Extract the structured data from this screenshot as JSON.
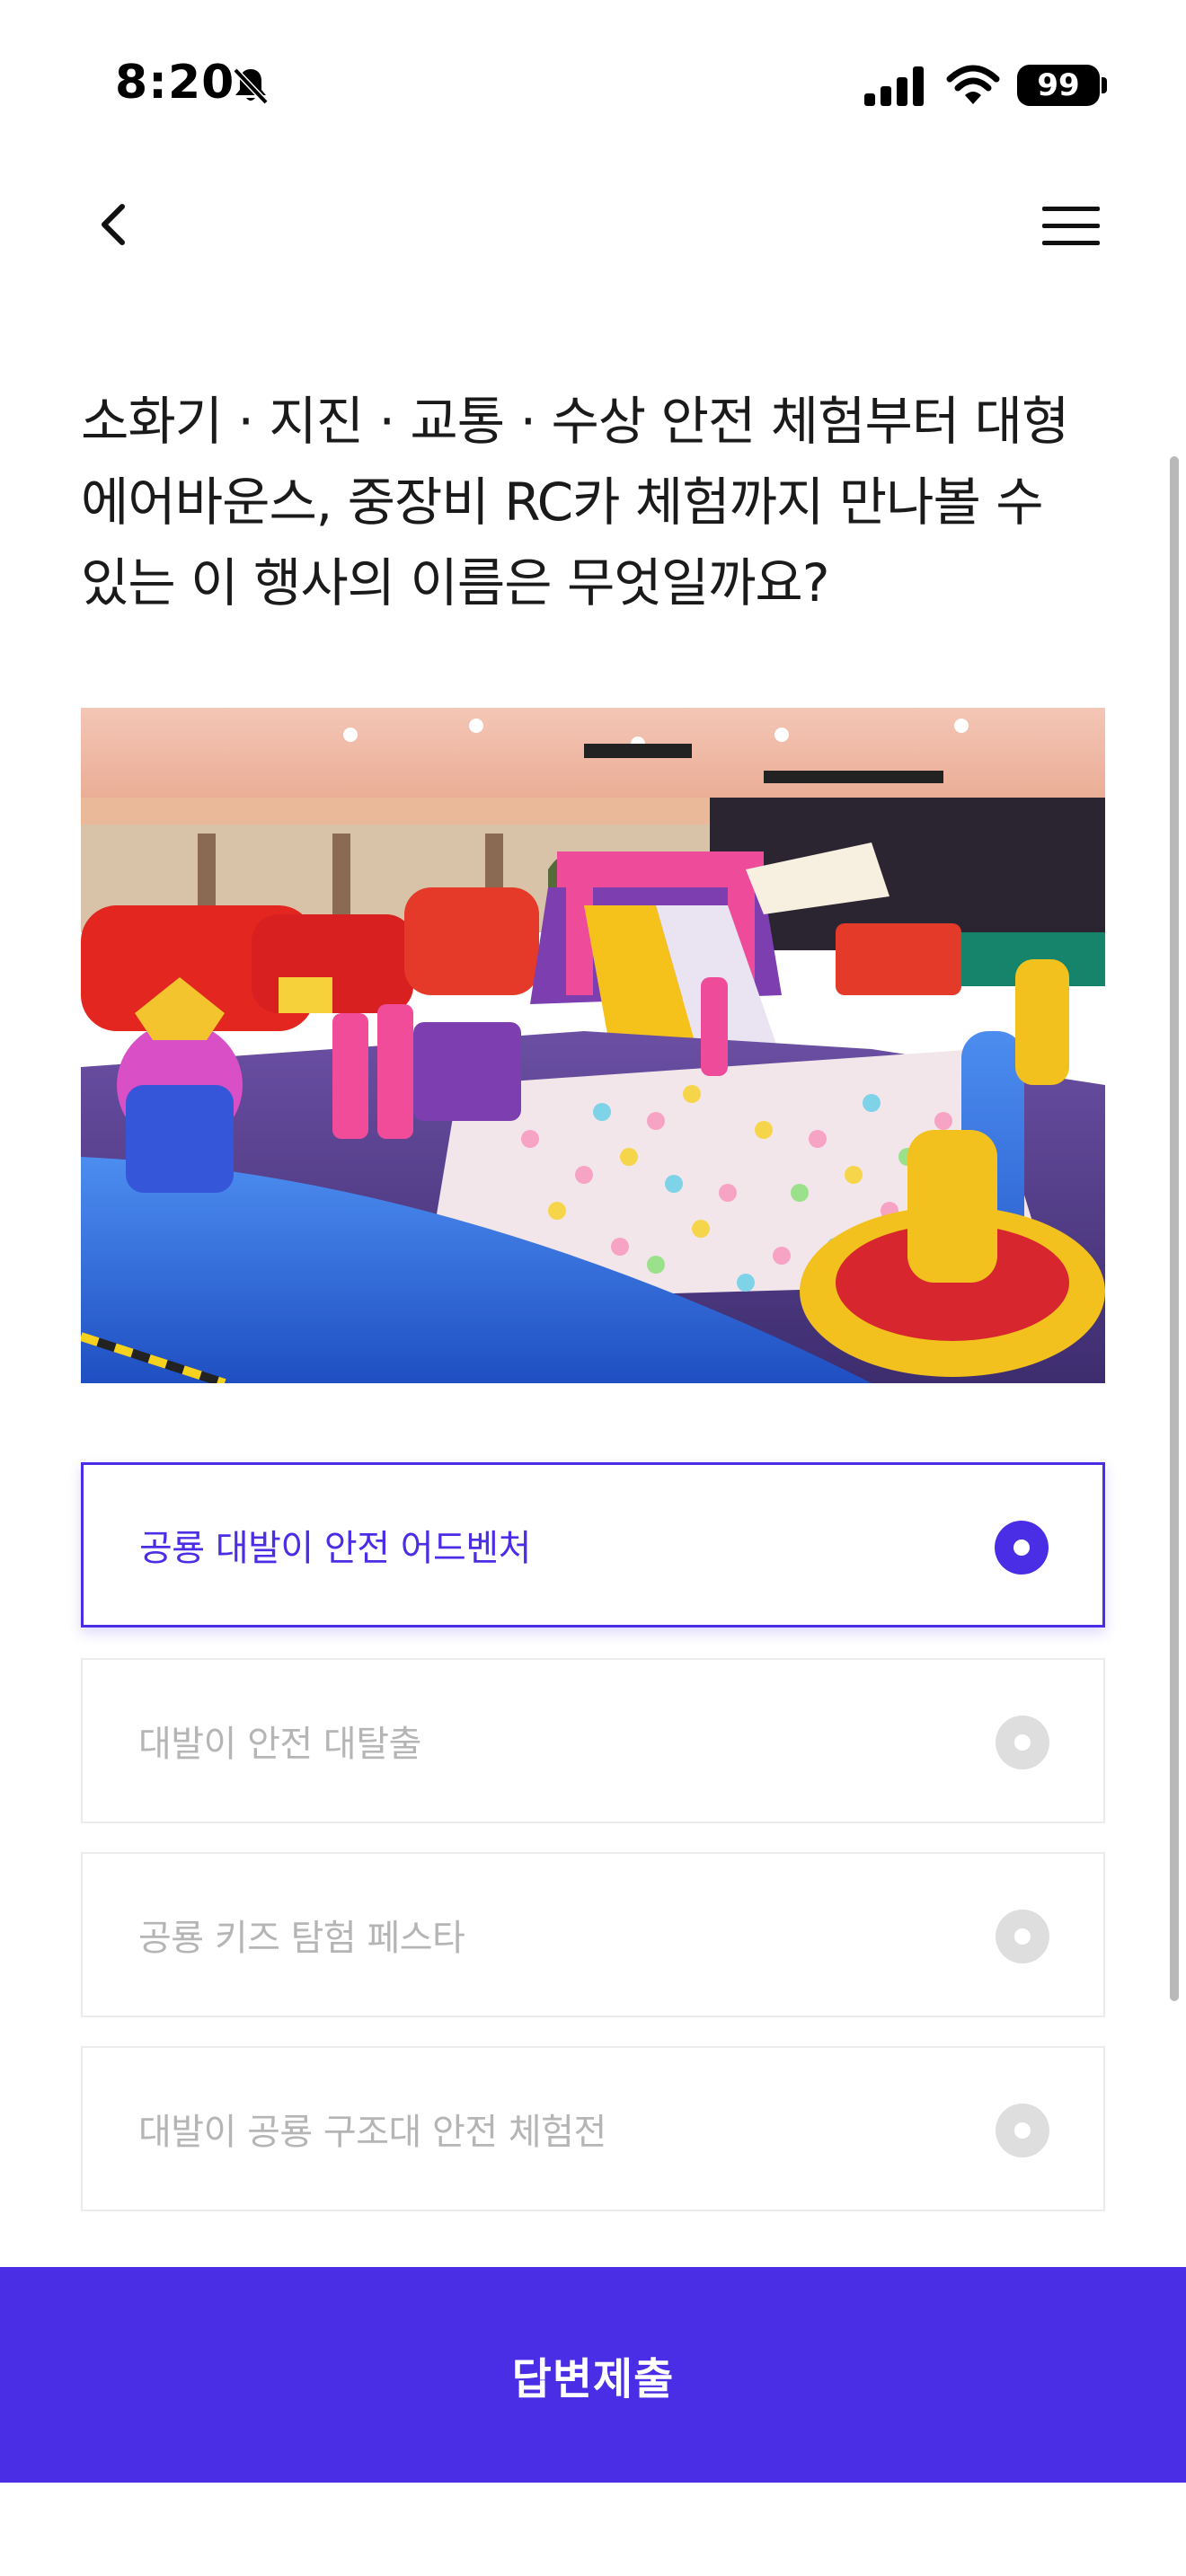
{
  "status_bar": {
    "time": "8:20",
    "battery": "99",
    "icons": [
      "bell-slash-icon",
      "cellular-signal-icon",
      "wifi-icon",
      "battery-icon"
    ]
  },
  "nav": {
    "back_icon": "chevron-left-icon",
    "menu_icon": "hamburger-menu-icon"
  },
  "question": {
    "text": "소화기 · 지진 · 교통 · 수상 안전 체험부터 대형 에어바운스, 중장비 RC카 체험까지 만나볼 수 있는 이 행사의 이름은 무엇일까요?"
  },
  "options": [
    {
      "label": "공룡 대발이 안전 어드벤처",
      "selected": true
    },
    {
      "label": "대발이 안전 대탈출",
      "selected": false
    },
    {
      "label": "공룡 키즈 탐험 페스타",
      "selected": false
    },
    {
      "label": "대발이 공룡 구조대 안전 체험전",
      "selected": false
    }
  ],
  "submit": {
    "label": "답변제출"
  },
  "colors": {
    "accent": "#4a2ee6",
    "option_border": "#ececec",
    "option_text_inactive": "#b5b5b5",
    "radio_inactive": "#dedede"
  }
}
